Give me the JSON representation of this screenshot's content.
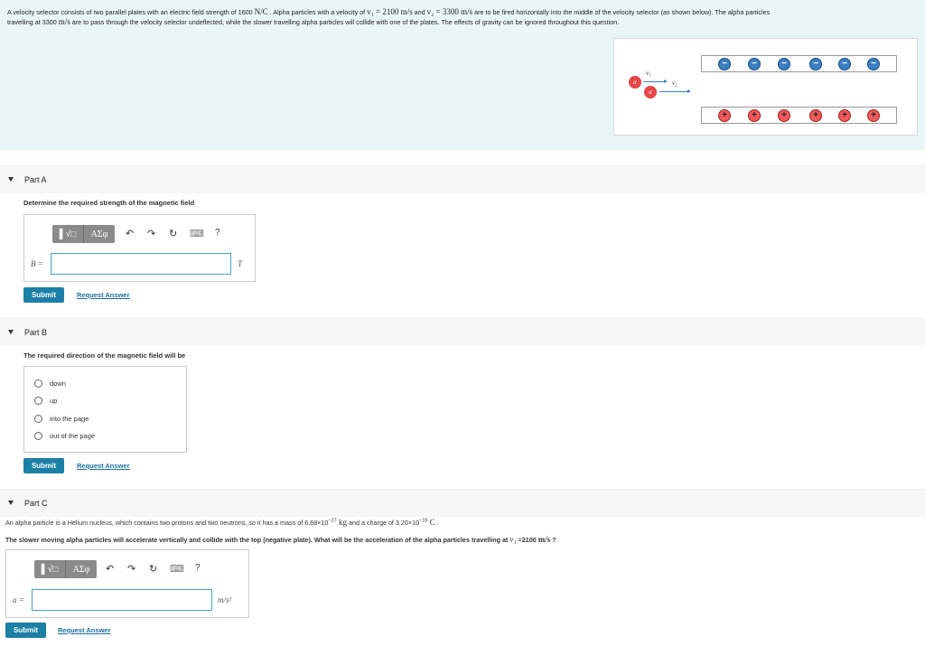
{
  "intro": {
    "line1_prefix": "A velocity selector consists of two parallel plates with an electric field strength of 1600 ",
    "field_unit": "N/C",
    "line1_mid1": " . Alpha particles with a velocity of ",
    "v1_expr": "v₁ = 2100 m/s",
    "line1_and": " and ",
    "v2_expr": "v₂ = 3300 m/s",
    "line1_suffix": " are to be fired horizontally into the middle of the velocity selector (as shown below). The alpha particles",
    "line2_prefix": "travelling at 3300 ",
    "speed_unit": "m/s",
    "line2_suffix": " are to pass through the velocity selector undeflected, while the slower travelling alpha particles will collide with one of the plates. The effects of gravity can be ignored throughout this question."
  },
  "figure": {
    "alpha_label": "α",
    "v1_label": "v₁",
    "v2_label": "v₂",
    "neg_symbol": "−",
    "pos_symbol": "+",
    "neg_color": "#3b7fc4",
    "pos_color": "#f05a5a"
  },
  "toolbar": {
    "sqrt_label": "▌√□",
    "greek_label": "ΑΣφ",
    "undo_icon": "↶",
    "redo_icon": "↷",
    "reset_icon": "↻",
    "keyboard_icon": "⌨",
    "help_icon": "?"
  },
  "partA": {
    "title": "Part A",
    "question": "Determine the required strength of the magnetic field",
    "var_label": "B =",
    "input_value": "",
    "unit": "T",
    "submit": "Submit",
    "request": "Request Answer"
  },
  "partB": {
    "title": "Part B",
    "question": "The required direction of the magnetic field will be",
    "options": [
      "down",
      "up",
      "into the page",
      "out of the page"
    ],
    "submit": "Submit",
    "request": "Request Answer"
  },
  "partC": {
    "title": "Part C",
    "info_prefix": "An alpha particle is a Helium nucleus, which contains two protons and two neutrons, so it has a mass of 6.68×10",
    "mass_exp": "−27",
    "mass_unit": " kg",
    "info_mid": " and a charge of 3.20×10",
    "charge_exp": "−19",
    "charge_unit": " C",
    "info_end": " .",
    "question_prefix": "The slower moving alpha particles will accelerate vertically and collide with the top (negative plate). What will be the acceleration of the alpha particles travelling at ",
    "question_v": "v₁",
    "question_value": " =2100 ",
    "question_unit": "m/s",
    "question_end": " ?",
    "var_label": "a =",
    "input_value": "",
    "unit": "m/s²",
    "submit": "Submit",
    "request": "Request Answer"
  }
}
